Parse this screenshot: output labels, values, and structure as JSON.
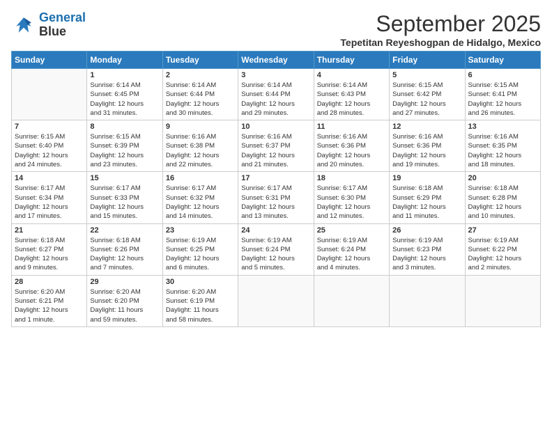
{
  "logo": {
    "line1": "General",
    "line2": "Blue"
  },
  "title": "September 2025",
  "location": "Tepetitan Reyeshogpan de Hidalgo, Mexico",
  "headers": [
    "Sunday",
    "Monday",
    "Tuesday",
    "Wednesday",
    "Thursday",
    "Friday",
    "Saturday"
  ],
  "weeks": [
    [
      {
        "day": "",
        "info": ""
      },
      {
        "day": "1",
        "info": "Sunrise: 6:14 AM\nSunset: 6:45 PM\nDaylight: 12 hours\nand 31 minutes."
      },
      {
        "day": "2",
        "info": "Sunrise: 6:14 AM\nSunset: 6:44 PM\nDaylight: 12 hours\nand 30 minutes."
      },
      {
        "day": "3",
        "info": "Sunrise: 6:14 AM\nSunset: 6:44 PM\nDaylight: 12 hours\nand 29 minutes."
      },
      {
        "day": "4",
        "info": "Sunrise: 6:14 AM\nSunset: 6:43 PM\nDaylight: 12 hours\nand 28 minutes."
      },
      {
        "day": "5",
        "info": "Sunrise: 6:15 AM\nSunset: 6:42 PM\nDaylight: 12 hours\nand 27 minutes."
      },
      {
        "day": "6",
        "info": "Sunrise: 6:15 AM\nSunset: 6:41 PM\nDaylight: 12 hours\nand 26 minutes."
      }
    ],
    [
      {
        "day": "7",
        "info": "Sunrise: 6:15 AM\nSunset: 6:40 PM\nDaylight: 12 hours\nand 24 minutes."
      },
      {
        "day": "8",
        "info": "Sunrise: 6:15 AM\nSunset: 6:39 PM\nDaylight: 12 hours\nand 23 minutes."
      },
      {
        "day": "9",
        "info": "Sunrise: 6:16 AM\nSunset: 6:38 PM\nDaylight: 12 hours\nand 22 minutes."
      },
      {
        "day": "10",
        "info": "Sunrise: 6:16 AM\nSunset: 6:37 PM\nDaylight: 12 hours\nand 21 minutes."
      },
      {
        "day": "11",
        "info": "Sunrise: 6:16 AM\nSunset: 6:36 PM\nDaylight: 12 hours\nand 20 minutes."
      },
      {
        "day": "12",
        "info": "Sunrise: 6:16 AM\nSunset: 6:36 PM\nDaylight: 12 hours\nand 19 minutes."
      },
      {
        "day": "13",
        "info": "Sunrise: 6:16 AM\nSunset: 6:35 PM\nDaylight: 12 hours\nand 18 minutes."
      }
    ],
    [
      {
        "day": "14",
        "info": "Sunrise: 6:17 AM\nSunset: 6:34 PM\nDaylight: 12 hours\nand 17 minutes."
      },
      {
        "day": "15",
        "info": "Sunrise: 6:17 AM\nSunset: 6:33 PM\nDaylight: 12 hours\nand 15 minutes."
      },
      {
        "day": "16",
        "info": "Sunrise: 6:17 AM\nSunset: 6:32 PM\nDaylight: 12 hours\nand 14 minutes."
      },
      {
        "day": "17",
        "info": "Sunrise: 6:17 AM\nSunset: 6:31 PM\nDaylight: 12 hours\nand 13 minutes."
      },
      {
        "day": "18",
        "info": "Sunrise: 6:17 AM\nSunset: 6:30 PM\nDaylight: 12 hours\nand 12 minutes."
      },
      {
        "day": "19",
        "info": "Sunrise: 6:18 AM\nSunset: 6:29 PM\nDaylight: 12 hours\nand 11 minutes."
      },
      {
        "day": "20",
        "info": "Sunrise: 6:18 AM\nSunset: 6:28 PM\nDaylight: 12 hours\nand 10 minutes."
      }
    ],
    [
      {
        "day": "21",
        "info": "Sunrise: 6:18 AM\nSunset: 6:27 PM\nDaylight: 12 hours\nand 9 minutes."
      },
      {
        "day": "22",
        "info": "Sunrise: 6:18 AM\nSunset: 6:26 PM\nDaylight: 12 hours\nand 7 minutes."
      },
      {
        "day": "23",
        "info": "Sunrise: 6:19 AM\nSunset: 6:25 PM\nDaylight: 12 hours\nand 6 minutes."
      },
      {
        "day": "24",
        "info": "Sunrise: 6:19 AM\nSunset: 6:24 PM\nDaylight: 12 hours\nand 5 minutes."
      },
      {
        "day": "25",
        "info": "Sunrise: 6:19 AM\nSunset: 6:24 PM\nDaylight: 12 hours\nand 4 minutes."
      },
      {
        "day": "26",
        "info": "Sunrise: 6:19 AM\nSunset: 6:23 PM\nDaylight: 12 hours\nand 3 minutes."
      },
      {
        "day": "27",
        "info": "Sunrise: 6:19 AM\nSunset: 6:22 PM\nDaylight: 12 hours\nand 2 minutes."
      }
    ],
    [
      {
        "day": "28",
        "info": "Sunrise: 6:20 AM\nSunset: 6:21 PM\nDaylight: 12 hours\nand 1 minute."
      },
      {
        "day": "29",
        "info": "Sunrise: 6:20 AM\nSunset: 6:20 PM\nDaylight: 11 hours\nand 59 minutes."
      },
      {
        "day": "30",
        "info": "Sunrise: 6:20 AM\nSunset: 6:19 PM\nDaylight: 11 hours\nand 58 minutes."
      },
      {
        "day": "",
        "info": ""
      },
      {
        "day": "",
        "info": ""
      },
      {
        "day": "",
        "info": ""
      },
      {
        "day": "",
        "info": ""
      }
    ]
  ]
}
